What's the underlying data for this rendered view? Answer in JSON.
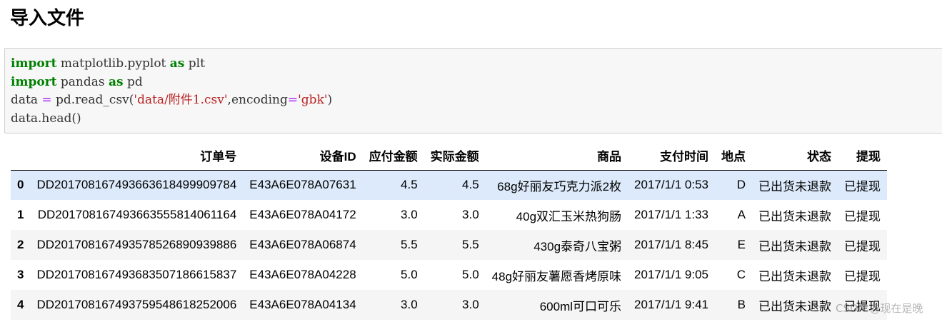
{
  "heading": "导入文件",
  "code_lines": [
    [
      {
        "t": "import",
        "c": "kw"
      },
      {
        "t": " matplotlib.pyplot ",
        "c": ""
      },
      {
        "t": "as",
        "c": "kw"
      },
      {
        "t": " plt",
        "c": ""
      }
    ],
    [
      {
        "t": "import",
        "c": "kw"
      },
      {
        "t": " pandas ",
        "c": ""
      },
      {
        "t": "as",
        "c": "kw"
      },
      {
        "t": " pd",
        "c": ""
      }
    ],
    [
      {
        "t": "data ",
        "c": ""
      },
      {
        "t": "=",
        "c": "op"
      },
      {
        "t": " pd.read_csv(",
        "c": ""
      },
      {
        "t": "'data/附件1.csv'",
        "c": "str"
      },
      {
        "t": ",encoding",
        "c": ""
      },
      {
        "t": "=",
        "c": "op"
      },
      {
        "t": "'gbk'",
        "c": "str"
      },
      {
        "t": ")",
        "c": ""
      }
    ],
    [
      {
        "t": "data.head()",
        "c": ""
      }
    ]
  ],
  "table": {
    "columns": [
      "",
      "订单号",
      "设备ID",
      "应付金额",
      "实际金额",
      "商品",
      "支付时间",
      "地点",
      "状态",
      "提现"
    ],
    "rows": [
      [
        "0",
        "DD201708167493663618499909784",
        "E43A6E078A07631",
        "4.5",
        "4.5",
        "68g好丽友巧克力派2枚",
        "2017/1/1 0:53",
        "D",
        "已出货未退款",
        "已提现"
      ],
      [
        "1",
        "DD201708167493663555814061164",
        "E43A6E078A04172",
        "3.0",
        "3.0",
        "40g双汇玉米热狗肠",
        "2017/1/1 1:33",
        "A",
        "已出货未退款",
        "已提现"
      ],
      [
        "2",
        "DD201708167493578526890939886",
        "E43A6E078A06874",
        "5.5",
        "5.5",
        "430g泰奇八宝粥",
        "2017/1/1 8:45",
        "E",
        "已出货未退款",
        "已提现"
      ],
      [
        "3",
        "DD201708167493683507186615837",
        "E43A6E078A04228",
        "5.0",
        "5.0",
        "48g好丽友薯愿香烤原味",
        "2017/1/1 9:05",
        "C",
        "已出货未退款",
        "已提现"
      ],
      [
        "4",
        "DD201708167493759548618252006",
        "E43A6E078A04134",
        "3.0",
        "3.0",
        "600ml可口可乐",
        "2017/1/1 9:41",
        "B",
        "已出货未退款",
        "已提现"
      ]
    ],
    "selected_row": 0
  },
  "watermark": "CSDN @现在是晚"
}
